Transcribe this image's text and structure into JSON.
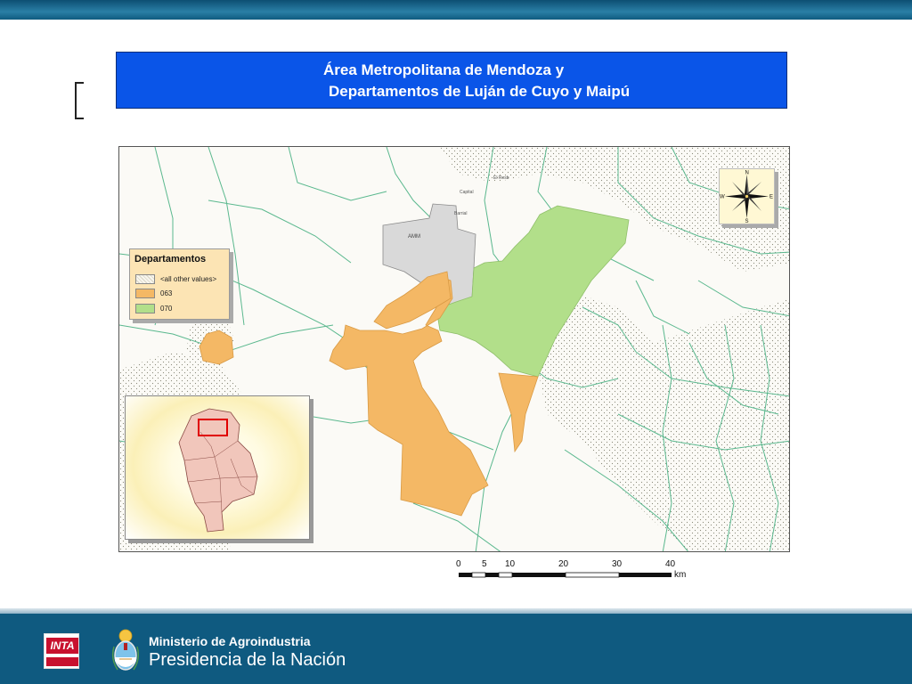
{
  "header": {
    "title_line1": "Área Metropolitana de Mendoza y",
    "title_line2": "Departamentos de  Luján de Cuyo y Maipú",
    "title_bg": "#0a55e8"
  },
  "map": {
    "labels": {
      "amm": "AMM",
      "town_1": "Capital",
      "town_2": "El Resb",
      "town_3": "Barrial"
    },
    "colors": {
      "dept_063": "#f4b865",
      "dept_070": "#b2df8a",
      "amm": "#d9d9d9",
      "roads": "#5ab88e",
      "background": "#fbfaf6"
    }
  },
  "legend": {
    "title": "Departamentos",
    "items": [
      {
        "label": "<all other values>",
        "color": "#f8f6ee"
      },
      {
        "label": "063",
        "color": "#f4b865"
      },
      {
        "label": "070",
        "color": "#b2df8a"
      }
    ]
  },
  "inset": {
    "province_color": "#f1c6bb",
    "highlight_color": "#e00000"
  },
  "compass": {
    "n": "N",
    "s": "S",
    "e": "E",
    "w": "W"
  },
  "scalebar": {
    "ticks": [
      "0",
      "5",
      "10",
      "20",
      "30",
      "40"
    ],
    "unit": "km"
  },
  "footer": {
    "logo_text": "INTA",
    "line1": "Ministerio de Agroindustria",
    "line2": "Presidencia de la Nación"
  }
}
